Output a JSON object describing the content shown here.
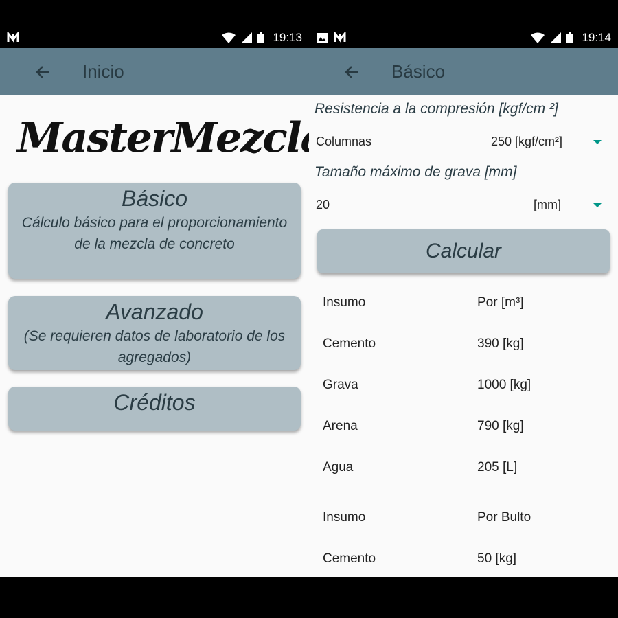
{
  "left": {
    "status": {
      "time": "19:13"
    },
    "appbar": {
      "title": "Inicio"
    },
    "logo": "MasterMezcla",
    "cards": [
      {
        "title": "Básico",
        "subtitle": "Cálculo básico para el proporcionamiento de la mezcla de concreto"
      },
      {
        "title": "Avanzado",
        "subtitle": "(Se requieren datos de laboratorio de los agregados)"
      },
      {
        "title": "Créditos"
      }
    ]
  },
  "right": {
    "status": {
      "time": "19:14"
    },
    "appbar": {
      "title": "Básico"
    },
    "resistencia": {
      "label": "Resistencia a la compresión [kgf/cm ²]",
      "tipo": "Columnas",
      "valor": "250 [kgf/cm²]"
    },
    "grava": {
      "label": "Tamaño máximo de grava [mm]",
      "valor": "20",
      "unidad": "[mm]"
    },
    "calcular_label": "Calcular",
    "results": [
      {
        "insumo": "Insumo",
        "cantidad": "Por [m³]"
      },
      {
        "insumo": "Cemento",
        "cantidad": "390 [kg]"
      },
      {
        "insumo": "Grava",
        "cantidad": "1000 [kg]"
      },
      {
        "insumo": "Arena",
        "cantidad": "790 [kg]"
      },
      {
        "insumo": "Agua",
        "cantidad": "205 [L]"
      },
      {
        "insumo": "Insumo",
        "cantidad": "Por Bulto"
      },
      {
        "insumo": "Cemento",
        "cantidad": "50 [kg]"
      }
    ]
  },
  "colors": {
    "appbar": "#5f7d8c",
    "card": "#afbec5",
    "accent": "#009688"
  },
  "icons": [
    "n-notification-icon",
    "image-notification-icon",
    "wifi-icon",
    "signal-icon",
    "battery-icon",
    "back-arrow-icon",
    "dropdown-arrow-icon"
  ]
}
